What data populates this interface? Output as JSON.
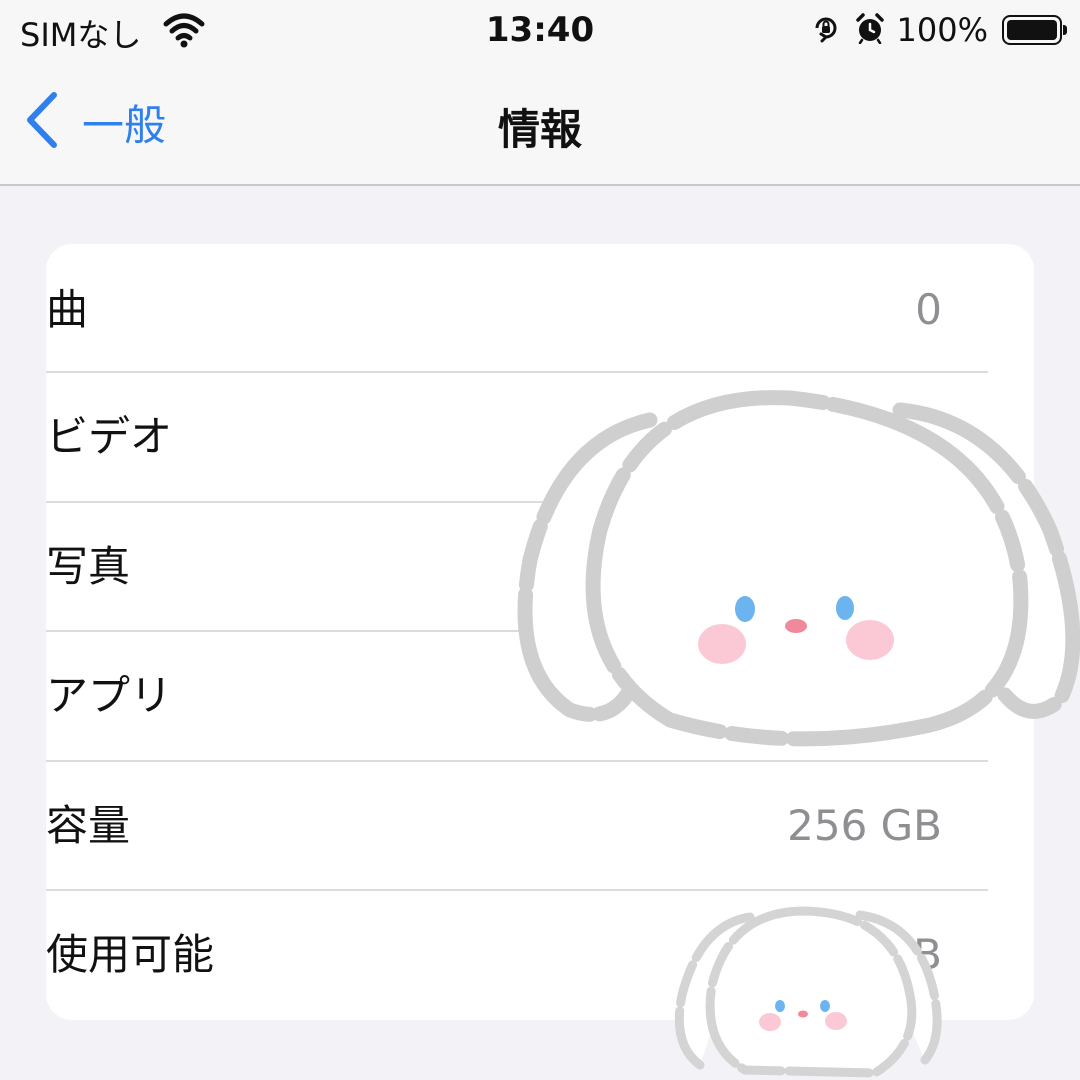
{
  "status_bar": {
    "carrier": "SIMなし",
    "time": "13:40",
    "battery_percent": "100%",
    "battery_level": 1.0,
    "icons": [
      "wifi-icon",
      "orientation-lock-icon",
      "alarm-icon",
      "battery-icon"
    ]
  },
  "nav": {
    "back_label": "一般",
    "title": "情報"
  },
  "rows": [
    {
      "label": "曲",
      "value": "0"
    },
    {
      "label": "ビデオ",
      "value": ""
    },
    {
      "label": "写真",
      "value": ""
    },
    {
      "label": "アプリ",
      "value": ""
    },
    {
      "label": "容量",
      "value": "256 GB"
    },
    {
      "label": "使用可能",
      "value": "GB"
    }
  ],
  "colors": {
    "accent": "#2f80ed",
    "background": "#f2f2f7",
    "secondary_text": "#8e8e93"
  },
  "stickers": [
    "bunny-sticker",
    "bunny-sticker-small"
  ]
}
